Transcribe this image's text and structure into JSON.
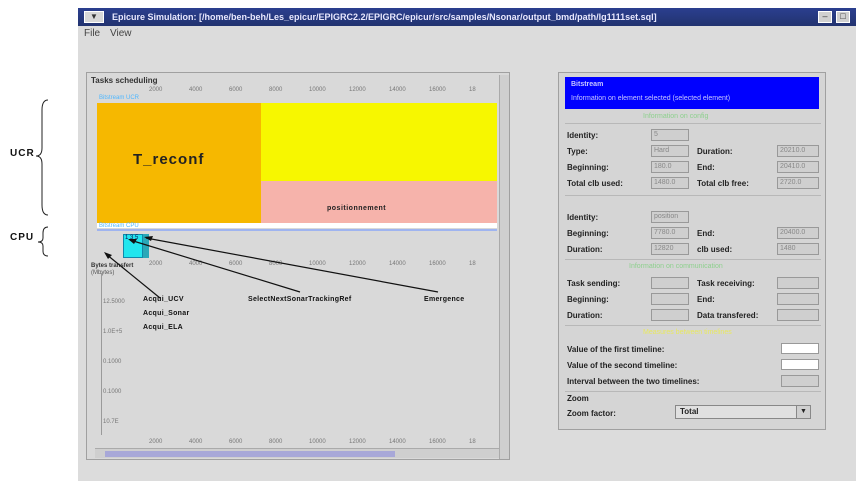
{
  "window": {
    "title": "Epicure Simulation: [/home/ben-beh/Les_epicur/EPIGRC2.2/EPIGRC/epicur/src/samples/Nsonar/output_bmd/path/lg1111set.sql]",
    "sys_label": "",
    "minimize": "–",
    "maximize": "□"
  },
  "menu": {
    "file": "File",
    "view": "View"
  },
  "tasks_panel": {
    "title": "Tasks scheduling",
    "ucr_label": "Bitstream UCR",
    "cpu_label": "Bitstream CPU",
    "cpu_block_label": "1 3 5",
    "ruler_top": [
      "2000",
      "4000",
      "6000",
      "8000",
      "10000",
      "12000",
      "14000",
      "16000",
      "18"
    ],
    "ruler_mid": [
      "2000",
      "4000",
      "6000",
      "8000",
      "10000",
      "12000",
      "14000",
      "16000",
      "18"
    ],
    "ruler_bottom": [
      "2000",
      "4000",
      "6000",
      "8000",
      "10000",
      "12000",
      "14000",
      "16000",
      "18"
    ],
    "bytes_title": "Bytes transfert",
    "bytes_unit": "(Mbytes)",
    "y_ticks": [
      "12.5000",
      "1.0E+5",
      "0.1000",
      "0.1000",
      "10.7E"
    ]
  },
  "info_panel": {
    "header_line1": "Bitstream",
    "header_line2": "Information on element selected (selected element)",
    "section1_green": "Information on config",
    "identity_label": "Identity:",
    "identity_value": "5",
    "type_label": "Type:",
    "type_value": "Hard",
    "duration_label": "Duration:",
    "duration_value": "20210.0",
    "beginning_label": "Beginning:",
    "beginning_value": "180.0",
    "end_label": "End:",
    "end_value": "20410.0",
    "total_clb_used_label": "Total clb used:",
    "total_clb_used_value": "1480.0",
    "total_clb_free_label": "Total clb free:",
    "total_clb_free_value": "2720.0",
    "identity2_label": "Identity:",
    "identity2_value": "position",
    "beginning2_label": "Beginning:",
    "beginning2_value": "7780.0",
    "end2_label": "End:",
    "end2_value": "20400.0",
    "duration2_label": "Duration:",
    "duration2_value": "12820",
    "clb_used_label": "clb used:",
    "clb_used_value": "1480",
    "section3_green": "Information on communication",
    "task_sending_label": "Task sending:",
    "task_receiving_label": "Task receiving:",
    "beginning3_label": "Beginning:",
    "end3_label": "End:",
    "duration3_label": "Duration:",
    "data_transfered_label": "Data transfered:",
    "section4_green": "Measures between timelines",
    "first_timeline_label": "Value of the first timeline:",
    "second_timeline_label": "Value of the second timeline:",
    "interval_label": "Interval between the two timelines:",
    "zoom_section_label": "Zoom",
    "zoom_factor_label": "Zoom factor:",
    "zoom_factor_value": "Total"
  },
  "annotations": {
    "ucr": "UCR",
    "cpu": "CPU",
    "t_reconf": "T_reconf",
    "positionnement": "positionnement",
    "acqui_ucv": "Acqui_UCV",
    "acqui_sonar": "Acqui_Sonar",
    "acqui_ela": "Acqui_ELA",
    "select_next": "SelectNextSonarTrackingRef",
    "emergence": "Emergence"
  },
  "colors": {
    "t_reconf_block": "#f6b800",
    "yellow_block": "#f7f700",
    "positionnement_block": "#f6b3ab",
    "cpu_block": "#22e6ee",
    "info_header": "#0000ff",
    "titlebar": "#2b3f8f"
  }
}
